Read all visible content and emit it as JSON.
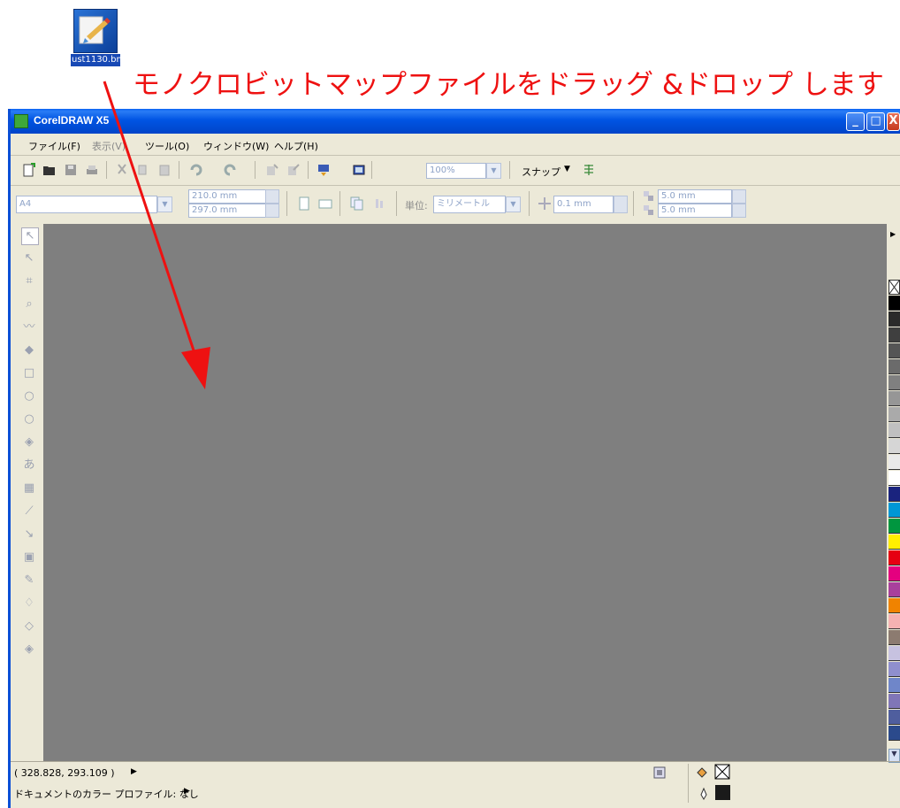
{
  "desktop": {
    "file_label": "ust1130.bm",
    "instruction": "モノクロビットマップファイルをドラッグ &ドロップ します"
  },
  "window": {
    "title": "CorelDRAW X5",
    "controls": {
      "minimize": "_",
      "maximize": "□",
      "close": "X"
    }
  },
  "menu": [
    "ファイル(F)",
    "表示(V)",
    "ツール(O)",
    "ウィンドウ(W)",
    "ヘルプ(H)"
  ],
  "toolbar": {
    "zoom_value": "100%",
    "snap_label": "スナップ"
  },
  "property_bar": {
    "page_size": "A4",
    "width": "210.0 mm",
    "height": "297.0 mm",
    "units_label": "単位:",
    "units_value": "ミリメートル",
    "nudge": "0.1 mm",
    "dup_x": "5.0 mm",
    "dup_y": "5.0 mm"
  },
  "status": {
    "coordinates": "( 328.828, 293.109 )",
    "color_profile": "ドキュメントのカラー プロファイル: なし"
  },
  "icons": [
    "new-document-icon",
    "open-folder-icon",
    "save-icon",
    "print-icon",
    "cut-icon",
    "copy-icon",
    "paste-icon",
    "undo-icon",
    "redo-icon",
    "import-icon",
    "export-icon",
    "application-launcher-icon",
    "welcome-screen-icon",
    "snap-icon",
    "fill-icon",
    "outline-pen-icon",
    "no-fill-icon"
  ],
  "palette_colors": [
    "#000000",
    "#2b2b2b",
    "#3f3f3f",
    "#555555",
    "#6b6b6b",
    "#808080",
    "#969696",
    "#aaaaaa",
    "#c0c0c0",
    "#d6d6d6",
    "#eaeaea",
    "#ffffff",
    "#1a237e",
    "#0097d6",
    "#00963f",
    "#ffef00",
    "#e60012",
    "#e4007f",
    "#a8409c",
    "#f08300",
    "#f5b2b2",
    "#8c7b70",
    "#c7c2e0",
    "#8f8fce",
    "#6f86c9",
    "#8076b7",
    "#4f5e9e",
    "#2b4a8c"
  ],
  "colors": {
    "title_blue": "#0054e3",
    "chrome": "#ece9d8",
    "canvas_gray": "#7f7f7f",
    "annotation_red": "#ee1111"
  }
}
